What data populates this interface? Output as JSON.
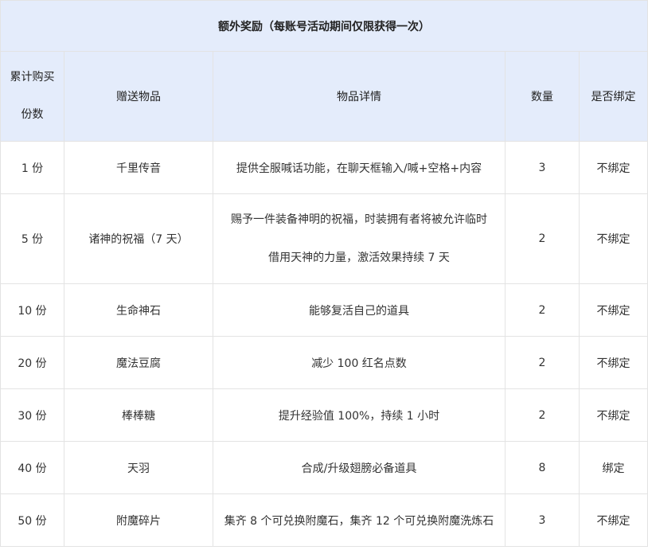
{
  "title": "额外奖励（每账号活动期间仅限获得一次）",
  "headers": {
    "count_line1": "累计购买",
    "count_line2": "份数",
    "item": "赠送物品",
    "detail": "物品详情",
    "quantity": "数量",
    "bound": "是否绑定"
  },
  "rows": [
    {
      "count": "1 份",
      "item": "千里传音",
      "detail": "提供全服喊话功能，在聊天框输入/喊+空格+内容",
      "detail2": "",
      "quantity": "3",
      "bound": "不绑定"
    },
    {
      "count": "5 份",
      "item": "诸神的祝福（7 天）",
      "detail": "赐予一件装备神明的祝福，时装拥有者将被允许临时",
      "detail2": "借用天神的力量，激活效果持续 7 天",
      "quantity": "2",
      "bound": "不绑定"
    },
    {
      "count": "10 份",
      "item": "生命神石",
      "detail": "能够复活自己的道具",
      "detail2": "",
      "quantity": "2",
      "bound": "不绑定"
    },
    {
      "count": "20 份",
      "item": "魔法豆腐",
      "detail": "减少 100 红名点数",
      "detail2": "",
      "quantity": "2",
      "bound": "不绑定"
    },
    {
      "count": "30 份",
      "item": "棒棒糖",
      "detail": "提升经验值 100%，持续 1 小时",
      "detail2": "",
      "quantity": "2",
      "bound": "不绑定"
    },
    {
      "count": "40 份",
      "item": "天羽",
      "detail": "合成/升级翅膀必备道具",
      "detail2": "",
      "quantity": "8",
      "bound": "绑定"
    },
    {
      "count": "50 份",
      "item": "附魔碎片",
      "detail": "集齐 8 个可兑换附魔石，集齐 12 个可兑换附魔洗炼石",
      "detail2": "",
      "quantity": "3",
      "bound": "不绑定"
    }
  ],
  "colors": {
    "header_bg": "#e4ecfb",
    "border": "#e3e3e3"
  }
}
